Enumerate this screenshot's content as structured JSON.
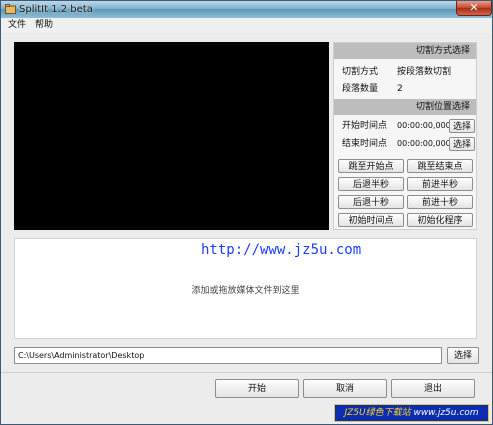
{
  "window": {
    "title": "SplitIt 1.2 beta",
    "close_glyph": "✕"
  },
  "menu": [
    {
      "label": "文件"
    },
    {
      "label": "帮助"
    }
  ],
  "split_mode": {
    "header": "切割方式选择",
    "mode_label": "切割方式",
    "mode_value": "按段落数切割",
    "count_label": "段落数量",
    "count_value": "2"
  },
  "split_position": {
    "header": "切割位置选择",
    "start_label": "开始时间点",
    "start_value": "00:00:00,000",
    "end_label": "结束时间点",
    "end_value": "00:00:00,000",
    "select_label": "选择"
  },
  "nav_buttons": [
    {
      "label": "跳至开始点"
    },
    {
      "label": "跳至结束点"
    },
    {
      "label": "后退半秒"
    },
    {
      "label": "前进半秒"
    },
    {
      "label": "后退十秒"
    },
    {
      "label": "前进十秒"
    },
    {
      "label": "初始时间点"
    },
    {
      "label": "初始化程序"
    }
  ],
  "drop_area": {
    "url_text": "http://www.jz5u.com",
    "hint": "添加或拖放媒体文件到这里"
  },
  "path": {
    "value": "C:\\Users\\Administrator\\Desktop",
    "select_label": "选择"
  },
  "actions": {
    "start": "开始",
    "cancel": "取消",
    "exit": "退出"
  },
  "badge": {
    "brand": "JZ5U绿色下载站",
    "url": "www.jz5u.com"
  },
  "colors": {
    "url_blue": "#1e3cff",
    "badge_bg": "#0a2db0",
    "badge_highlight": "#ffd21e"
  }
}
